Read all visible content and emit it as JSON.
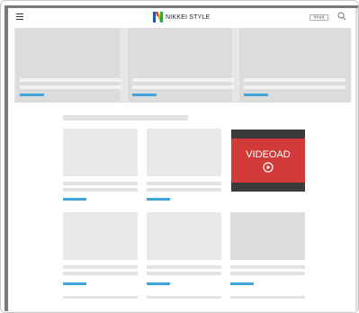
{
  "header": {
    "menu_icon": "hamburger-menu-icon",
    "logo_text": "NIKKEI STYLE",
    "logo_icon": "nikkei-n-logo-icon",
    "top_button_label": "有料会員",
    "search_icon": "search-icon"
  },
  "video_ad": {
    "label": "VIDEOAD",
    "icon": "play-circle-icon"
  },
  "colors": {
    "accent": "#3aa6dc",
    "ad_red": "#d23a3a",
    "ad_dark": "#3a3a3a",
    "placeholder": "#e9e9e9"
  }
}
